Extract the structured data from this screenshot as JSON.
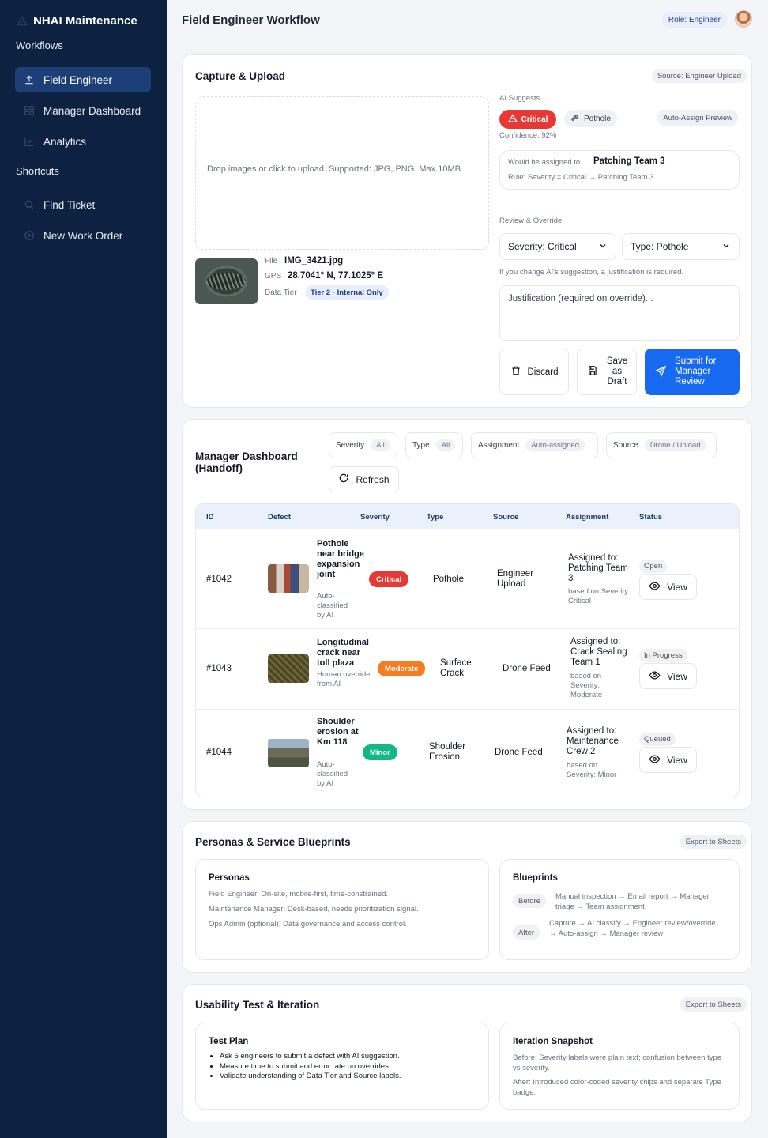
{
  "sidebar": {
    "brand": "NHAI Maintenance",
    "workflows_label": "Workflows",
    "nav": [
      {
        "label": "Field Engineer",
        "icon": "upload-icon"
      },
      {
        "label": "Manager Dashboard",
        "icon": "grid-icon"
      },
      {
        "label": "Analytics",
        "icon": "chart-icon"
      }
    ],
    "shortcuts_label": "Shortcuts",
    "shortcuts": [
      {
        "label": "Find Ticket",
        "icon": "search-icon"
      },
      {
        "label": "New Work Order",
        "icon": "plus-circle-icon"
      }
    ]
  },
  "header": {
    "title": "Field Engineer Workflow",
    "role": "Role: Engineer"
  },
  "capture": {
    "title": "Capture & Upload",
    "source_pill": "Source: Engineer Upload",
    "drop_text": "Drop images or click to upload. Supported: JPG, PNG. Max 10MB.",
    "file_label": "File",
    "file_value": "IMG_3421.jpg",
    "gps_label": "GPS",
    "gps_value": "28.7041° N, 77.1025° E",
    "tier_label": "Data Tier",
    "tier_value": "Tier 2 · Internal Only",
    "ai_suggests": "AI Suggests",
    "severity_chip": "Critical",
    "type_chip": "Pothole",
    "auto_assign_preview": "Auto-Assign Preview",
    "confidence": "Confidence: 92%",
    "assign_prefix": "Would be assigned to",
    "assign_team": "Patching Team 3",
    "rule": "Rule: Severity = Critical → Patching Team 3",
    "review_label": "Review & Override",
    "severity_select": "Severity: Critical",
    "type_select": "Type: Pothole",
    "override_note": "If you change AI's suggestion, a justification is required.",
    "justification_placeholder": "Justification (required on override)...",
    "discard": "Discard",
    "save_draft": "Save as Draft",
    "submit": "Submit for Manager Review"
  },
  "dashboard": {
    "title": "Manager Dashboard (Handoff)",
    "filters": [
      {
        "label": "Severity",
        "value": "All"
      },
      {
        "label": "Type",
        "value": "All"
      },
      {
        "label": "Assignment",
        "value": "Auto-assigned"
      },
      {
        "label": "Source",
        "value": "Drone / Upload"
      }
    ],
    "refresh": "Refresh",
    "columns": [
      "ID",
      "Defect",
      "Severity",
      "Type",
      "Source",
      "Assignment",
      "Status"
    ],
    "rows": [
      {
        "id": "#1042",
        "defect": "Pothole near bridge expansion joint",
        "sub": "Auto-classified by AI",
        "severity": "Critical",
        "type": "Pothole",
        "source": "Engineer Upload",
        "assign": "Assigned to: Patching Team 3",
        "assign_basis": "based on Severity: Critical",
        "status": "Open",
        "view": "View"
      },
      {
        "id": "#1043",
        "defect": "Longitudinal crack near toll plaza",
        "sub": "Human override from AI",
        "severity": "Moderate",
        "type": "Surface Crack",
        "source": "Drone Feed",
        "assign": "Assigned to: Crack Sealing Team 1",
        "assign_basis": "based on Severity: Moderate",
        "status": "In Progress",
        "view": "View"
      },
      {
        "id": "#1044",
        "defect": "Shoulder erosion at Km 118",
        "sub": "Auto-classified by AI",
        "severity": "Minor",
        "type": "Shoulder Erosion",
        "source": "Drone Feed",
        "assign": "Assigned to: Maintenance Crew 2",
        "assign_basis": "based on Severity: Minor",
        "status": "Queued",
        "view": "View"
      }
    ],
    "colors": {
      "critical": "#e53935",
      "moderate": "#f57c1f",
      "minor": "#12b886"
    }
  },
  "personas": {
    "title": "Personas & Service Blueprints",
    "export": "Export to Sheets",
    "personas_title": "Personas",
    "personas_lines": [
      "Field Engineer: On-site, mobile-first, time-constrained.",
      "Maintenance Manager: Desk-based, needs prioritization signal.",
      "Ops Admin (optional): Data governance and access control."
    ],
    "blueprints_title": "Blueprints",
    "before_tag": "Before",
    "before_text": "Manual inspection → Email report → Manager triage → Team assignment",
    "after_tag": "After",
    "after_text": "Capture → AI classify → Engineer review/override → Auto-assign → Manager review"
  },
  "usability": {
    "title": "Usability Test & Iteration",
    "export": "Export to Sheets",
    "plan_title": "Test Plan",
    "plan_items": [
      "Ask 5 engineers to submit a defect with AI suggestion.",
      "Measure time to submit and error rate on overrides.",
      "Validate understanding of Data Tier and Source labels."
    ],
    "snapshot_title": "Iteration Snapshot",
    "before": "Before: Severity labels were plain text; confusion between type vs severity.",
    "after": "After: Introduced color-coded severity chips and separate Type badge."
  },
  "accent": "#1769f0",
  "sidebar_bg": "#0d2240"
}
